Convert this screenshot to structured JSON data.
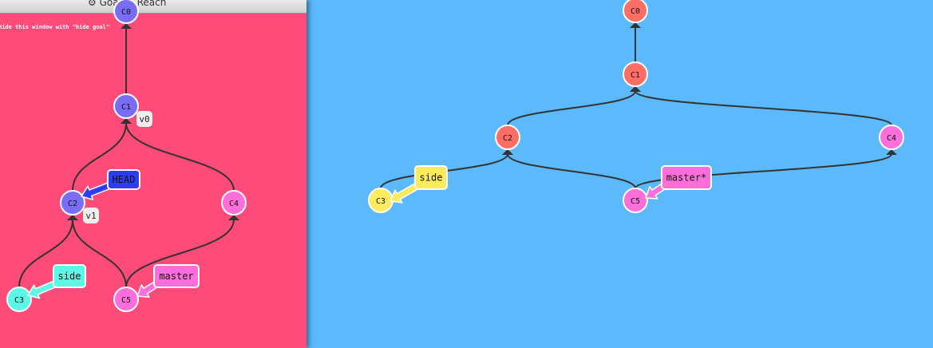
{
  "goal_window": {
    "title": "Goal to Reach",
    "hint": "Hide this window with \"hide goal\"",
    "background": "#ff4b79",
    "commit_color": "#7b6cf6",
    "icon": "gear-icon"
  },
  "goal_tree": {
    "commits": [
      {
        "id": "C0",
        "label": "C0",
        "color": "#7b6cf6"
      },
      {
        "id": "C1",
        "label": "C1",
        "color": "#7b6cf6"
      },
      {
        "id": "C2",
        "label": "C2",
        "color": "#7b6cf6"
      },
      {
        "id": "C3",
        "label": "C3",
        "color": "#5cf8e6"
      },
      {
        "id": "C4",
        "label": "C4",
        "color": "#ff6edb"
      },
      {
        "id": "C5",
        "label": "C5",
        "color": "#ff6edb"
      }
    ],
    "edges": [
      [
        "C1",
        "C0"
      ],
      [
        "C2",
        "C1"
      ],
      [
        "C4",
        "C1"
      ],
      [
        "C3",
        "C2"
      ],
      [
        "C5",
        "C2"
      ],
      [
        "C5",
        "C4"
      ]
    ],
    "tags": [
      {
        "label": "v0",
        "commit": "C1"
      },
      {
        "label": "v1",
        "commit": "C2"
      }
    ],
    "branches": [
      {
        "label": "HEAD",
        "commit": "C2",
        "color": "#2f3cf6"
      },
      {
        "label": "side",
        "commit": "C3",
        "color": "#5cf8e6"
      },
      {
        "label": "master",
        "commit": "C5",
        "color": "#ff6edb"
      }
    ]
  },
  "main_tree": {
    "background": "#5cb9fc",
    "commits": [
      {
        "id": "C0",
        "label": "C0",
        "color": "#ff6e64"
      },
      {
        "id": "C1",
        "label": "C1",
        "color": "#ff6e64"
      },
      {
        "id": "C2",
        "label": "C2",
        "color": "#ff6e64"
      },
      {
        "id": "C3",
        "label": "C3",
        "color": "#fceb5c"
      },
      {
        "id": "C4",
        "label": "C4",
        "color": "#ff6edb"
      },
      {
        "id": "C5",
        "label": "C5",
        "color": "#ff6edb"
      }
    ],
    "edges": [
      [
        "C1",
        "C0"
      ],
      [
        "C2",
        "C1"
      ],
      [
        "C4",
        "C1"
      ],
      [
        "C3",
        "C2"
      ],
      [
        "C5",
        "C2"
      ],
      [
        "C5",
        "C4"
      ]
    ],
    "branches": [
      {
        "label": "side",
        "commit": "C3",
        "color": "#fceb5c"
      },
      {
        "label": "master*",
        "commit": "C5",
        "color": "#ff6edb"
      }
    ]
  }
}
